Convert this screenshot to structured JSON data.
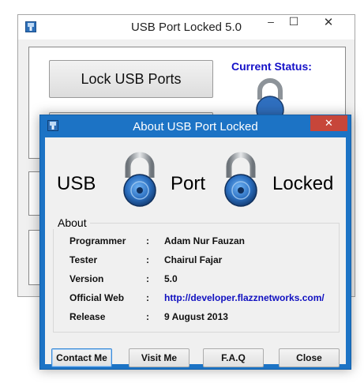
{
  "main_window": {
    "title": "USB Port Locked 5.0",
    "minimize_glyph": "–",
    "maximize_glyph": "☐",
    "close_glyph": "✕",
    "lock_button_label": "Lock USB Ports",
    "status_label": "Current Status:",
    "status_icon": "padlock-icon"
  },
  "about_dialog": {
    "title": "About USB Port Locked",
    "close_glyph": "✕",
    "brand": {
      "word1": "USB",
      "word2": "Port",
      "word3": "Locked",
      "icon": "padlock-icon"
    },
    "group_label": "About",
    "rows": [
      {
        "label": "Programmer",
        "colon": ":",
        "value": "Adam Nur Fauzan"
      },
      {
        "label": "Tester",
        "colon": ":",
        "value": "Chairul Fajar"
      },
      {
        "label": "Version",
        "colon": ":",
        "value": "5.0"
      },
      {
        "label": "Official Web",
        "colon": ":",
        "value": "http://developer.flazznetworks.com/"
      },
      {
        "label": "Release",
        "colon": ":",
        "value": "9 August 2013"
      }
    ],
    "buttons": {
      "contact": "Contact Me",
      "visit": "Visit Me",
      "faq": "F.A.Q",
      "close": "Close"
    }
  },
  "colors": {
    "dialog_frame": "#1c73c5",
    "status_label": "#1410c8",
    "link": "#1010c0",
    "close_button": "#c7463a"
  }
}
